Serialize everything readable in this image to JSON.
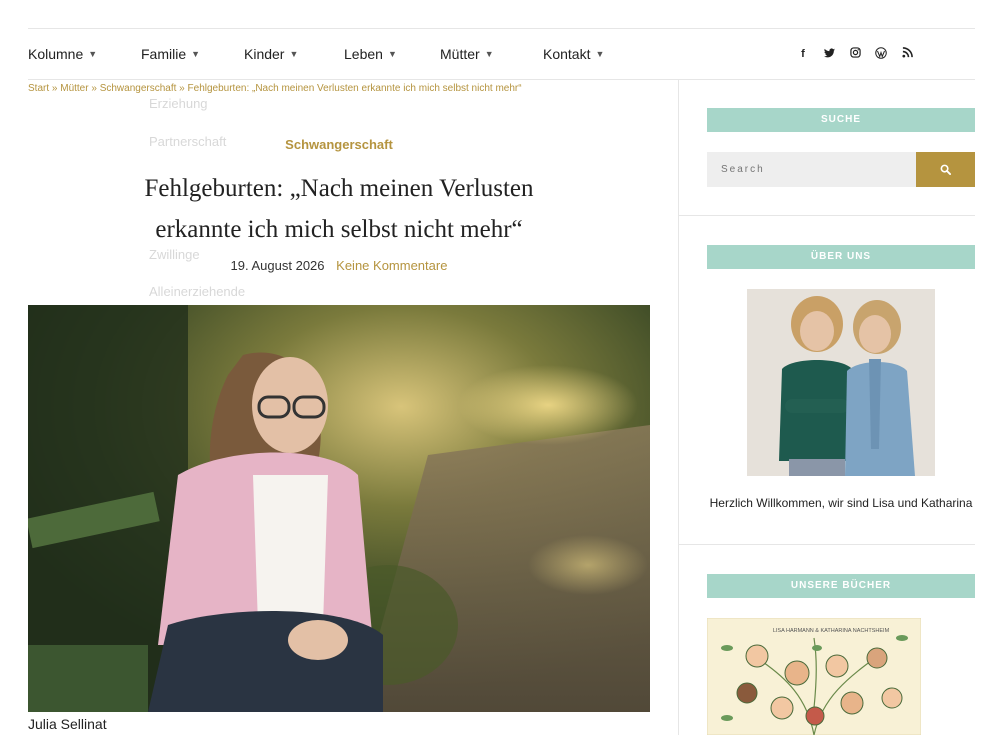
{
  "nav": {
    "items": [
      {
        "label": "Kolumne"
      },
      {
        "label": "Familie"
      },
      {
        "label": "Kinder"
      },
      {
        "label": "Leben"
      },
      {
        "label": "Mütter"
      },
      {
        "label": "Kontakt"
      }
    ],
    "social_icons": [
      "facebook-icon",
      "twitter-icon",
      "instagram-icon",
      "wordpress-icon",
      "rss-icon"
    ]
  },
  "breadcrumb": "Start » Mütter » Schwangerschaft » Fehlgeburten: „Nach meinen Verlusten erkannte ich mich selbst nicht mehr“",
  "dropdown_ghost": {
    "items": [
      "Erziehung",
      "Partnerschaft",
      "Zwillinge",
      "Alleinerziehende"
    ]
  },
  "article": {
    "category": "Schwangerschaft",
    "title": "Fehlgeburten: „Nach meinen Verlusten erkannte ich mich selbst nicht mehr“",
    "date": "19. August 2026",
    "comments": "Keine Kommentare",
    "caption": "Julia Sellinat"
  },
  "sidebar": {
    "search": {
      "title": "SUCHE",
      "placeholder": "Search"
    },
    "about": {
      "title": "ÜBER UNS",
      "text": "Herzlich Willkommen, wir sind Lisa und Katharina"
    },
    "books": {
      "title": "UNSERE BÜCHER",
      "cover_text": "LISA HARMANN & KATHARINA NACHTSHEIM"
    }
  },
  "colors": {
    "accent": "#b5943f",
    "mint": "#a7d6c9"
  }
}
